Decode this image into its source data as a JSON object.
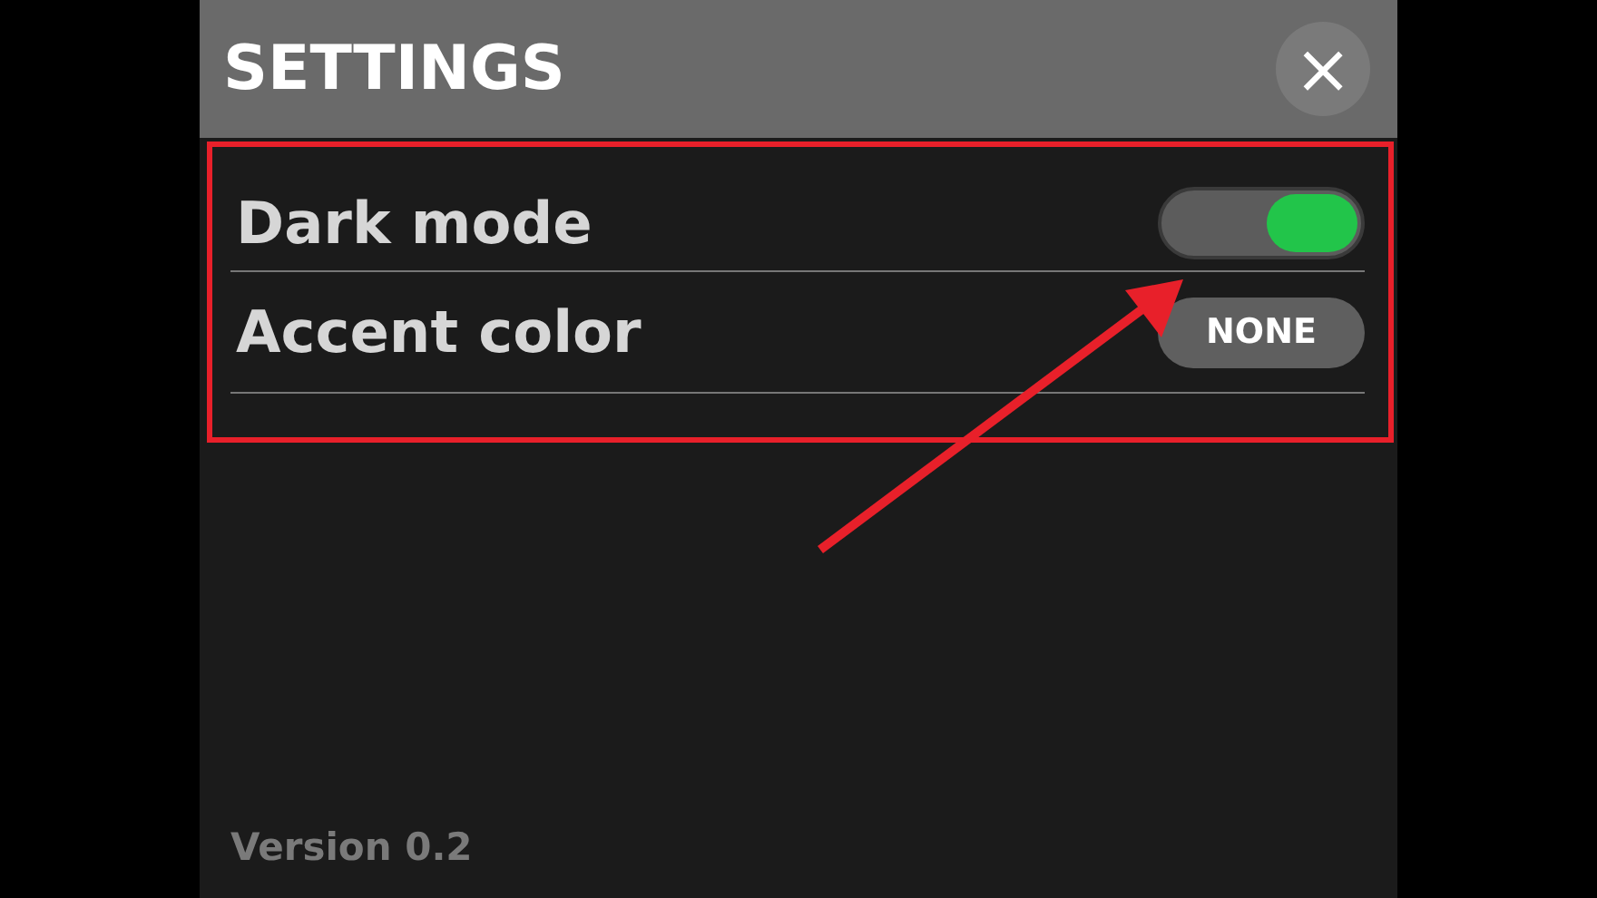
{
  "window": {
    "title": "SETTINGS",
    "close_button": "×"
  },
  "settings": [
    {
      "kind": "toggle",
      "label": "Dark mode",
      "on": true
    },
    {
      "kind": "choice",
      "label": "Accent color",
      "value": "NONE"
    }
  ],
  "version": "Version 0.2"
}
